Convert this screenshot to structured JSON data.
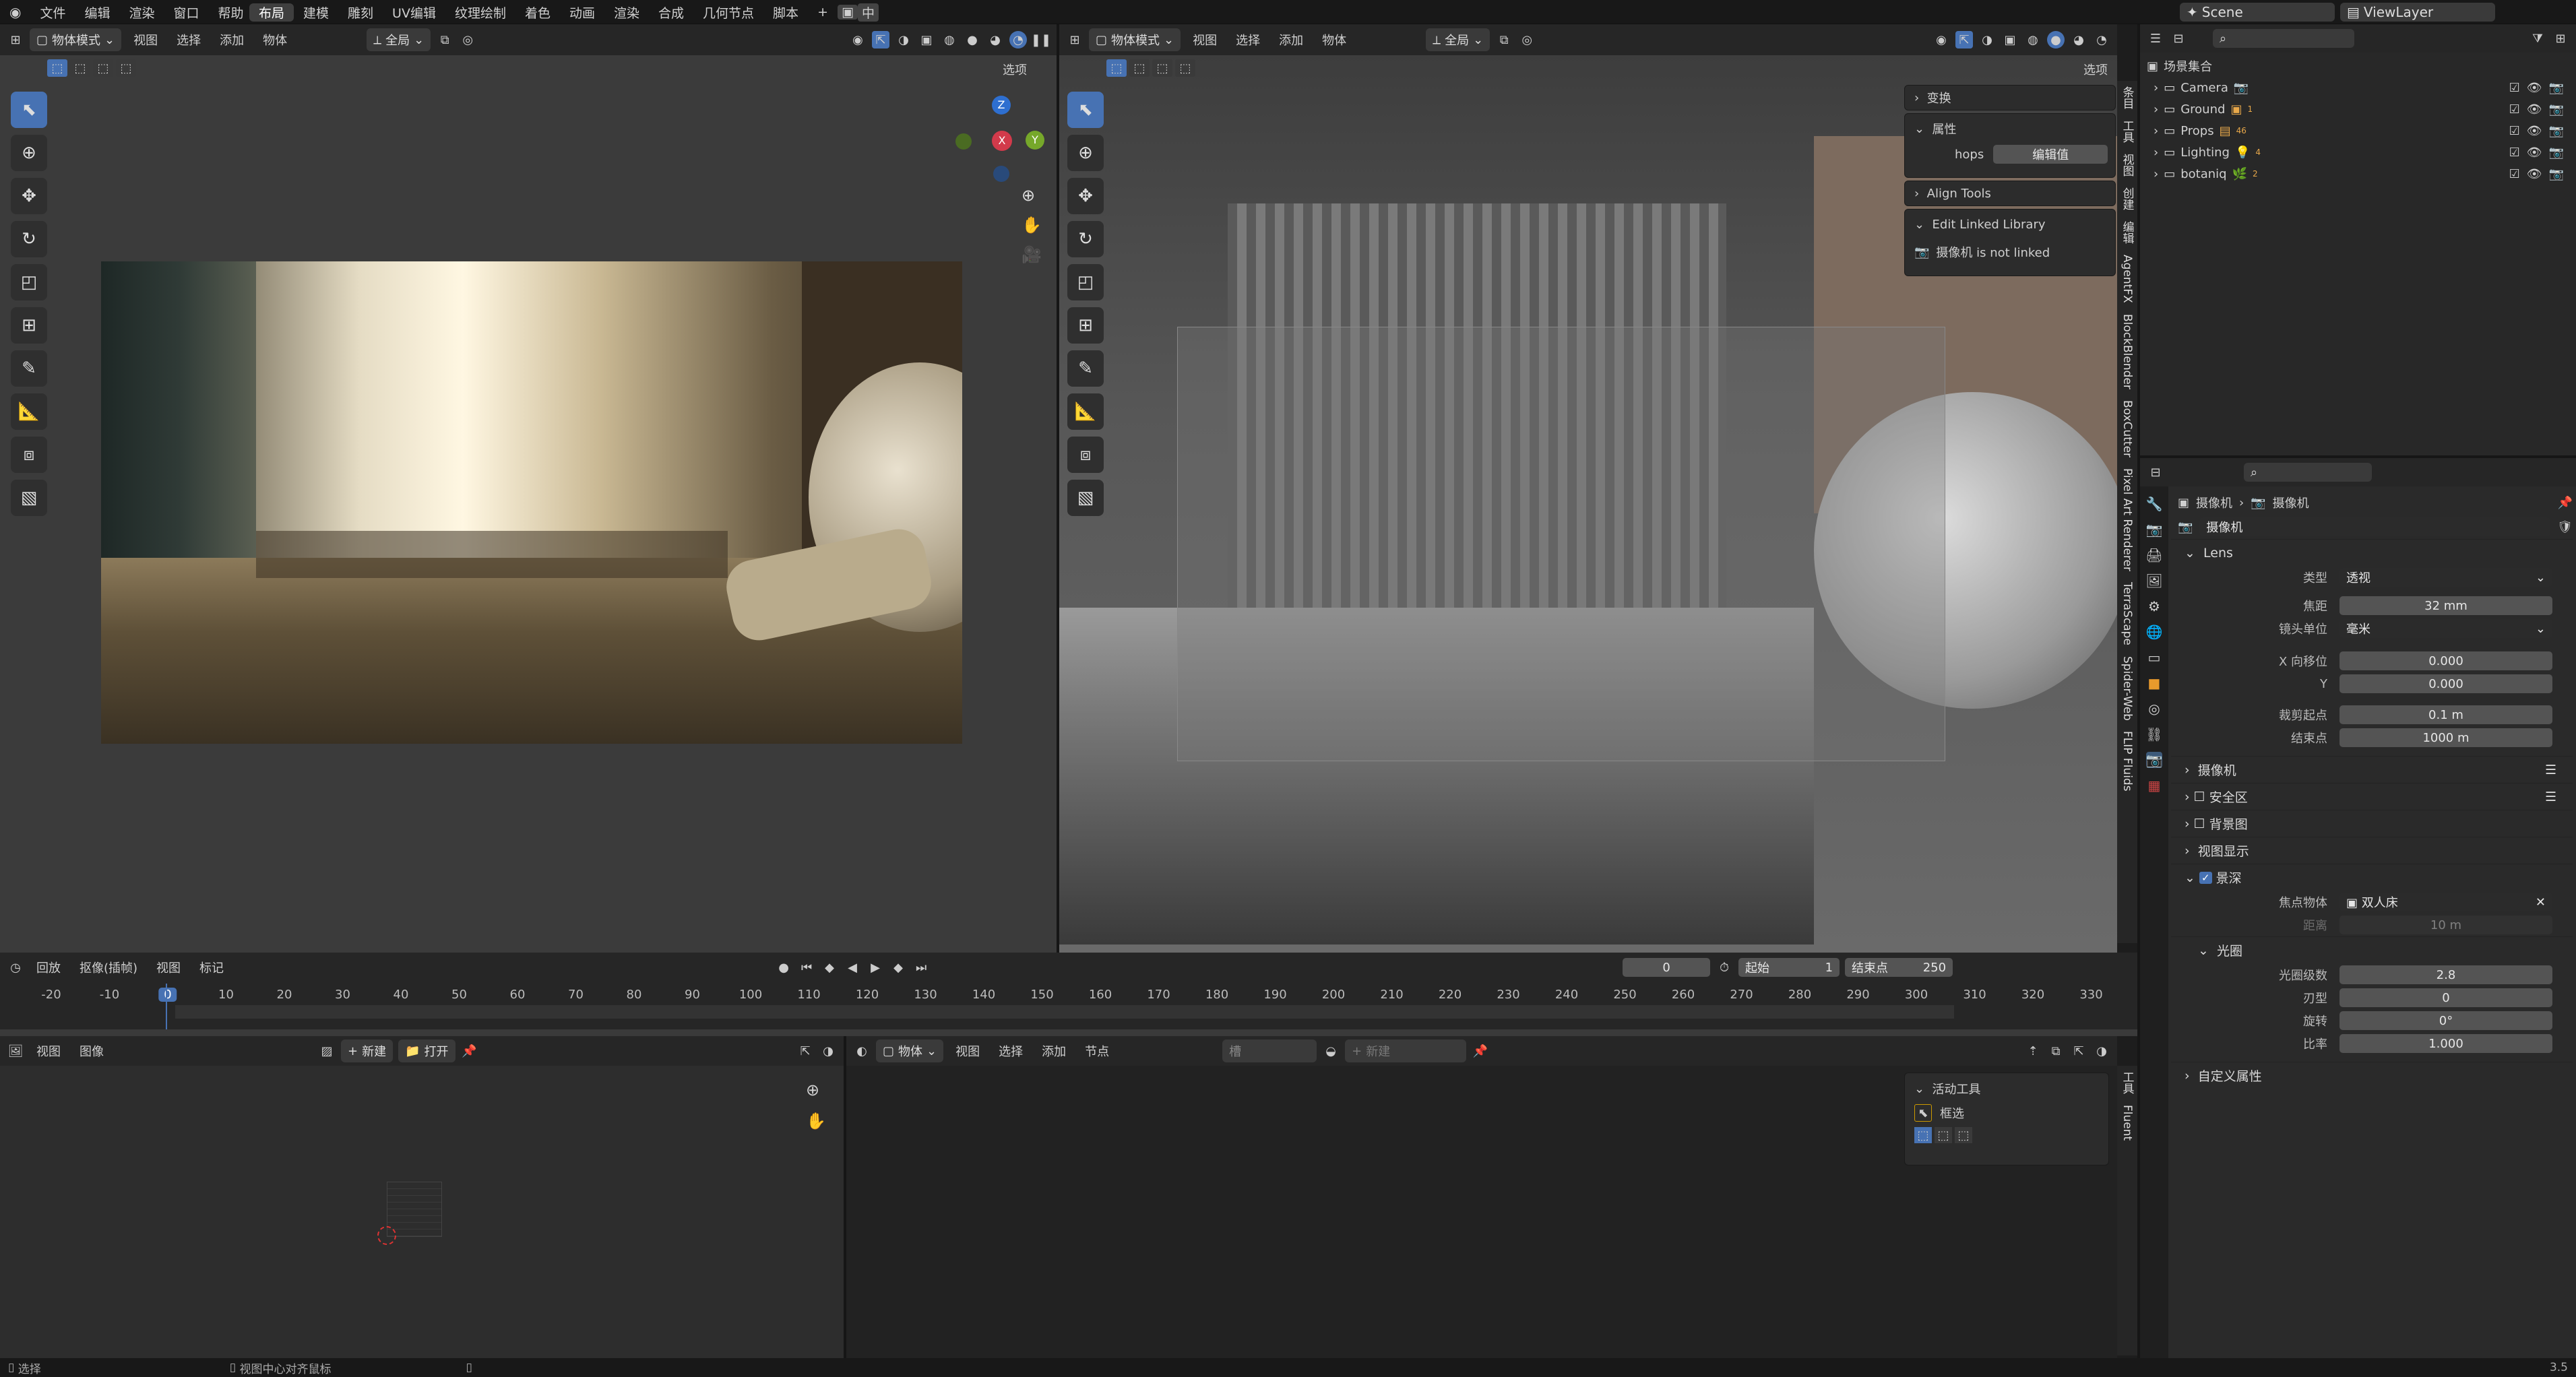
{
  "topbar": {
    "menus": [
      "文件",
      "编辑",
      "渲染",
      "窗口",
      "帮助"
    ],
    "workspaces": [
      "布局",
      "建模",
      "雕刻",
      "UV编辑",
      "纹理绘制",
      "着色",
      "动画",
      "渲染",
      "合成",
      "几何节点",
      "脚本"
    ],
    "active_workspace": "布局",
    "add_tab": "+",
    "ime_label": "中",
    "scene": "Scene",
    "view_layer": "ViewLayer"
  },
  "left_viewport": {
    "mode": "物体模式",
    "menus": [
      "视图",
      "选择",
      "添加",
      "物体"
    ],
    "transform": "全局",
    "options": "选项"
  },
  "right_viewport": {
    "mode": "物体模式",
    "menus": [
      "视图",
      "选择",
      "添加",
      "物体"
    ],
    "transform": "全局",
    "options": "选项",
    "npanel": {
      "transform": "变换",
      "properties": "属性",
      "hops_label": "hops",
      "hops_button": "编辑值",
      "align_tools": "Align Tools",
      "edit_linked": "Edit Linked Library",
      "camera_not_linked": "摄像机 is not linked"
    },
    "side_tabs": [
      "条目",
      "工具",
      "视图",
      "创建",
      "编辑",
      "AgentFX",
      "BlockBlender",
      "BoxCutter",
      "Pixel Art Renderer",
      "TerraScape",
      "Spider-Web",
      "FLIP Fluids"
    ]
  },
  "gizmo": {
    "z": "Z",
    "x": "X",
    "y": "Y"
  },
  "timeline": {
    "menus": [
      "回放",
      "抠像(插帧)",
      "视图",
      "标记"
    ],
    "current_frame": "0",
    "start_label": "起始",
    "start": "1",
    "end_label": "结束点",
    "end": "250",
    "ticks": [
      "-20",
      "-10",
      "0",
      "10",
      "20",
      "30",
      "40",
      "50",
      "60",
      "70",
      "80",
      "90",
      "100",
      "110",
      "120",
      "130",
      "140",
      "150",
      "160",
      "170",
      "180",
      "190",
      "200",
      "210",
      "220",
      "230",
      "240",
      "250",
      "260",
      "270",
      "280",
      "290",
      "300",
      "310",
      "320",
      "330"
    ]
  },
  "image_editor": {
    "menus": [
      "视图",
      "图像"
    ],
    "new_btn": "新建",
    "open_btn": "打开"
  },
  "node_editor": {
    "type": "物体",
    "menus": [
      "视图",
      "选择",
      "添加",
      "节点"
    ],
    "slot": "槽",
    "new_btn": "新建",
    "active_tool_title": "活动工具",
    "tool_name": "框选",
    "side_tabs": [
      "工具",
      "Fluent"
    ]
  },
  "outliner": {
    "search_placeholder": "",
    "collection": "场景集合",
    "items": [
      {
        "name": "Camera",
        "sub": ""
      },
      {
        "name": "Ground",
        "sub": "1"
      },
      {
        "name": "Props",
        "sub": "46"
      },
      {
        "name": "Lighting",
        "sub": "4"
      },
      {
        "name": "botaniq",
        "sub": "2"
      }
    ]
  },
  "properties": {
    "breadcrumb_1": "摄像机",
    "breadcrumb_2": "摄像机",
    "datablock": "摄像机",
    "lens_title": "Lens",
    "type_label": "类型",
    "type_value": "透视",
    "focal_label": "焦距",
    "focal_value": "32 mm",
    "unit_label": "镜头单位",
    "unit_value": "毫米",
    "shiftx_label": "X 向移位",
    "shiftx_value": "0.000",
    "shifty_label": "Y",
    "shifty_value": "0.000",
    "clip_start_label": "裁剪起点",
    "clip_start_value": "0.1 m",
    "clip_end_label": "结束点",
    "clip_end_value": "1000 m",
    "camera_sec": "摄像机",
    "safe_sec": "安全区",
    "bg_sec": "背景图",
    "viewport_sec": "视图显示",
    "dof_sec": "景深",
    "focus_obj_label": "焦点物体",
    "focus_obj_value": "双人床",
    "distance_label": "距离",
    "distance_value": "10 m",
    "aperture_sec": "光圈",
    "fstop_label": "光圈级数",
    "fstop_value": "2.8",
    "blades_label": "刃型",
    "blades_value": "0",
    "rotation_label": "旋转",
    "rotation_value": "0°",
    "ratio_label": "比率",
    "ratio_value": "1.000",
    "custom_sec": "自定义属性"
  },
  "statusbar": {
    "left": "选择",
    "mid": "视图中心对齐鼠标",
    "version": "3.5"
  }
}
